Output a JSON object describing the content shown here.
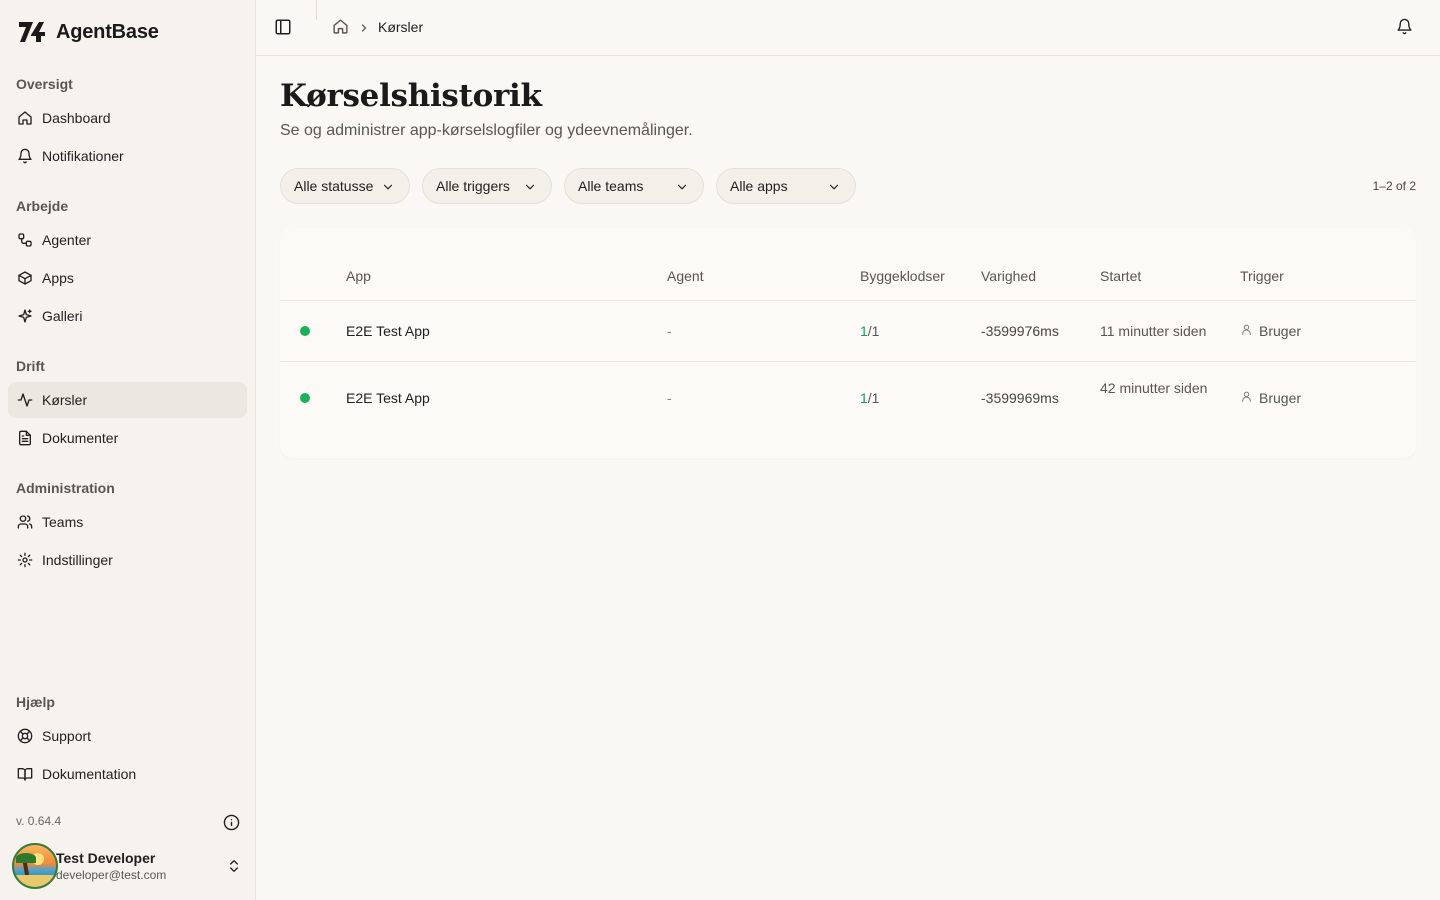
{
  "brand": {
    "name": "AgentBase"
  },
  "sidebar": {
    "sections": [
      {
        "title": "Oversigt",
        "items": [
          {
            "label": "Dashboard",
            "icon": "home-icon"
          },
          {
            "label": "Notifikationer",
            "icon": "bell-icon"
          }
        ]
      },
      {
        "title": "Arbejde",
        "items": [
          {
            "label": "Agenter",
            "icon": "workflow-icon"
          },
          {
            "label": "Apps",
            "icon": "box-icon"
          },
          {
            "label": "Galleri",
            "icon": "sparkles-icon"
          }
        ]
      },
      {
        "title": "Drift",
        "items": [
          {
            "label": "Kørsler",
            "icon": "activity-icon",
            "active": true
          },
          {
            "label": "Dokumenter",
            "icon": "document-icon"
          }
        ]
      },
      {
        "title": "Administration",
        "items": [
          {
            "label": "Teams",
            "icon": "users-icon"
          },
          {
            "label": "Indstillinger",
            "icon": "gear-icon"
          }
        ]
      },
      {
        "title": "Hjælp",
        "items": [
          {
            "label": "Support",
            "icon": "lifebuoy-icon"
          },
          {
            "label": "Dokumentation",
            "icon": "book-icon"
          }
        ]
      }
    ],
    "version": "v. 0.64.4",
    "user": {
      "name": "Test Developer",
      "email": "developer@test.com"
    }
  },
  "header": {
    "breadcrumb_current": "Kørsler"
  },
  "page": {
    "title": "Kørselshistorik",
    "subtitle": "Se og administrer app-kørselslogfiler og ydeevnemålinger.",
    "filters": [
      "Alle statusse",
      "Alle triggers",
      "Alle teams",
      "Alle apps"
    ],
    "count": "1–2 of 2"
  },
  "table": {
    "columns": [
      "App",
      "Agent",
      "Byggeklodser",
      "Varighed",
      "Startet",
      "Trigger"
    ],
    "rows": [
      {
        "status": "success",
        "status_color": "#16b35a",
        "app": "E2E Test App",
        "agent": "-",
        "blocks_done": "1",
        "blocks_total": "/1",
        "duration": "-3599976ms",
        "started": "11 minutter siden",
        "trigger": "Bruger"
      },
      {
        "status": "success",
        "status_color": "#16b35a",
        "app": "E2E Test App",
        "agent": "-",
        "blocks_done": "1",
        "blocks_total": "/1",
        "duration": "-3599969ms",
        "started": "42 minutter siden",
        "trigger": "Bruger"
      }
    ]
  }
}
